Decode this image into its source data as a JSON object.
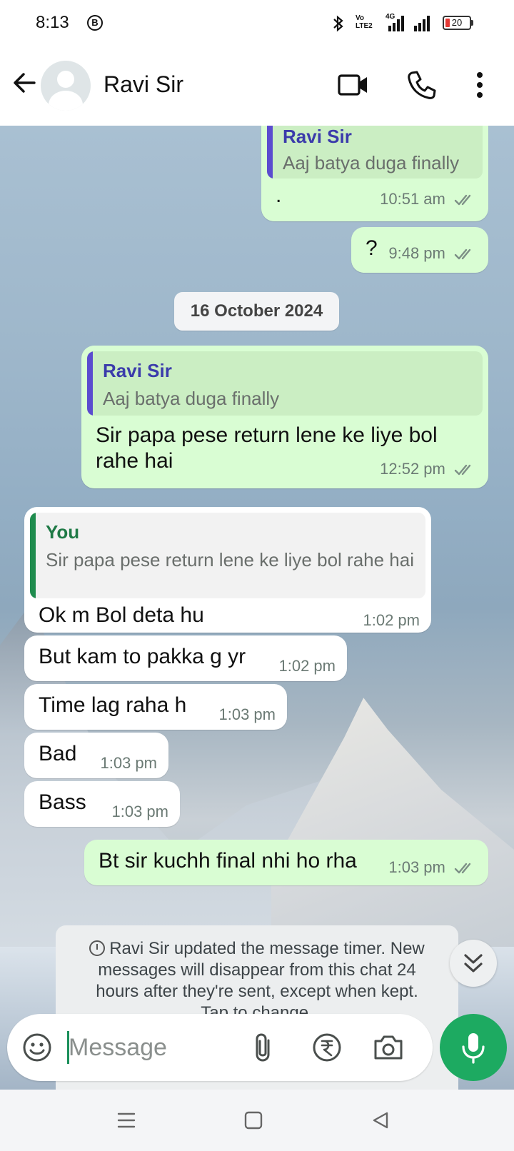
{
  "status_bar": {
    "time": "8:13",
    "badge": "B",
    "volte": "Vo LTE2",
    "network": "4G",
    "battery": "20",
    "battery_level": 0.2
  },
  "header": {
    "contact_name": "Ravi Sir",
    "icons": [
      "back-arrow-icon",
      "video-call-icon",
      "phone-icon",
      "more-vert-icon"
    ]
  },
  "messages": [
    {
      "dir": "out",
      "quote_author": "Ravi Sir",
      "quote_text": "Aaj batya duga finally",
      "text": ".",
      "time": "10:51 am",
      "read": true
    },
    {
      "dir": "out",
      "text": "?",
      "time": "9:48 pm",
      "read": true
    },
    {
      "dir": "date",
      "text": "16 October 2024"
    },
    {
      "dir": "out",
      "quote_author": "Ravi Sir",
      "quote_text": "Aaj batya duga finally",
      "text": "Sir papa pese return lene ke liye bol rahe hai",
      "time": "12:52 pm",
      "read": true
    },
    {
      "dir": "in",
      "quote_author": "You",
      "quote_text": "Sir papa pese return lene ke liye bol rahe hai",
      "text": "Ok m Bol deta hu",
      "time": "1:02 pm"
    },
    {
      "dir": "in",
      "text": "But kam to pakka g yr",
      "time": "1:02 pm"
    },
    {
      "dir": "in",
      "text": "Time lag raha h",
      "time": "1:03 pm"
    },
    {
      "dir": "in",
      "text": "Bad",
      "time": "1:03 pm"
    },
    {
      "dir": "in",
      "text": "Bass",
      "time": "1:03 pm"
    },
    {
      "dir": "out",
      "text": "Bt sir kuchh final nhi ho rha",
      "time": "1:03 pm",
      "read": true
    }
  ],
  "system_note": {
    "line1": "Ravi Sir updated the message timer. New",
    "line2": "messages will disappear from this chat 24",
    "line3": "hours after they're sent, except when kept.",
    "line4": "Tap to change."
  },
  "composer": {
    "placeholder": "Message",
    "icons": [
      "emoji-icon",
      "attach-icon",
      "rupee-payment-icon",
      "camera-icon",
      "mic-icon"
    ]
  },
  "colors": {
    "outgoing_bubble": "#d9fdd3",
    "incoming_bubble": "#ffffff",
    "read_ticks": "#53bdeb",
    "accent_green": "#1daa61",
    "quote_ravi": "#5b4ccf",
    "quote_you": "#1f8c4e"
  }
}
